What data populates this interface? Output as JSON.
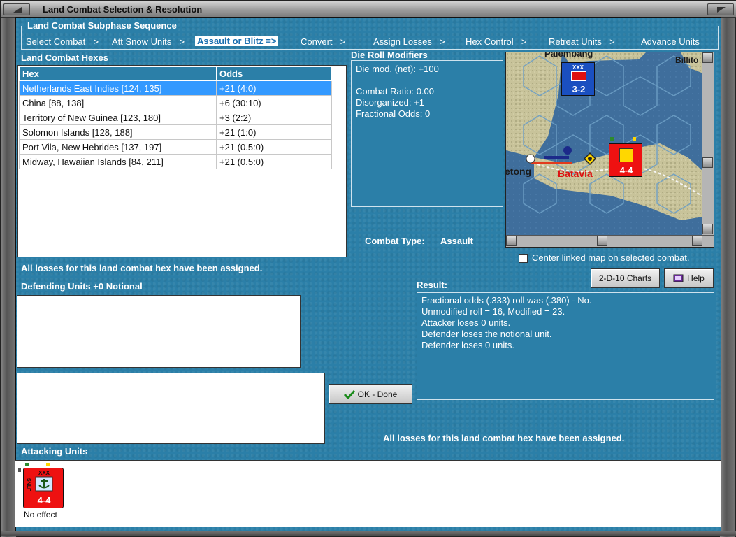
{
  "window": {
    "title": "Land Combat Selection & Resolution"
  },
  "subphase": {
    "title": "Land Combat Subphase Sequence",
    "steps": [
      {
        "label": "Select Combat =>"
      },
      {
        "label": "Att Snow Units =>"
      },
      {
        "label": "Assault or Blitz =>",
        "active": true
      },
      {
        "label": "Convert =>"
      },
      {
        "label": "Assign Losses =>"
      },
      {
        "label": "Hex Control =>"
      },
      {
        "label": "Retreat Units =>"
      },
      {
        "label": "Advance Units"
      }
    ]
  },
  "hexes": {
    "heading": "Land Combat Hexes",
    "columns": [
      "Hex",
      "Odds"
    ],
    "rows": [
      {
        "hex": "Netherlands East Indies [124, 135]",
        "odds": "+21 (4:0)",
        "selected": true
      },
      {
        "hex": "China [88, 138]",
        "odds": "+6 (30:10)"
      },
      {
        "hex": "Territory of New Guinea [123, 180]",
        "odds": "+3 (2:2)"
      },
      {
        "hex": "Solomon Islands [128, 188]",
        "odds": "+21 (1:0)"
      },
      {
        "hex": "Port Vila, New Hebrides [137, 197]",
        "odds": "+21 (0.5:0)"
      },
      {
        "hex": "Midway, Hawaiian Islands [84, 211]",
        "odds": "+21 (0.5:0)"
      }
    ]
  },
  "die_roll": {
    "heading": "Die Roll Modifiers",
    "net": "Die mod. (net): +100",
    "ratio": "Combat Ratio: 0.00",
    "disorganized": "Disorganized: +1",
    "fractional": "Fractional Odds: 0"
  },
  "combat_type": {
    "label": "Combat Type:",
    "value": "Assault"
  },
  "map": {
    "places": {
      "palembang": "Palembang",
      "billiton": "Billito",
      "betong": "etong",
      "batavia": "Batavia"
    },
    "unit_def": {
      "value": "3-2",
      "size": "XXX"
    },
    "unit_att": {
      "value": "4-4",
      "size": "XXX"
    },
    "center_option": "Center linked map on selected combat."
  },
  "status_top": "All losses for this land combat hex have been assigned.",
  "defending": {
    "heading": "Defending Units +0 Notional"
  },
  "buttons": {
    "charts": "2-D-10 Charts",
    "help": "Help",
    "ok": "OK - Done"
  },
  "result": {
    "heading": "Result:",
    "lines": [
      "Fractional odds (.333) roll was (.380)  - No.",
      "Unmodified roll = 16, Modified = 23.",
      "Attacker loses 0 units.",
      "Defender loses the notional unit.",
      "Defender loses 0 units."
    ]
  },
  "status_bottom": "All losses for this land combat hex have been assigned.",
  "attacking": {
    "heading": "Attacking Units",
    "unit": {
      "value": "4-4",
      "size": "XXX",
      "side_text": "SNLF",
      "effect": "No effect"
    }
  },
  "colors": {
    "panel_blue": "#2b7fa8",
    "selected_row": "#3399ff",
    "attacker_red": "#ee1111",
    "defender_blue": "#1a4fc0"
  }
}
